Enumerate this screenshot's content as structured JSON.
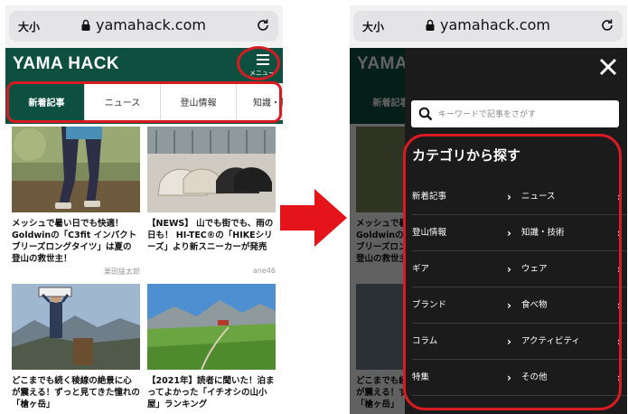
{
  "browser": {
    "aa_label": "大小",
    "domain": "yamahack.com"
  },
  "site": {
    "logo": "YAMA HACK",
    "menu_label": "メニュー"
  },
  "tabs": [
    "新着記事",
    "ニュース",
    "登山情報",
    "知識・技"
  ],
  "articles": [
    {
      "title": "メッシュで暑い日でも快適！Goldwinの「C3fit インパクトブリーズロングタイツ」は夏の登山の救世主！",
      "author": "栗田猛太郎"
    },
    {
      "title": "【NEWS】 山でも街でも、雨の日も！ HI-TEC®の「HIKEシリーズ」より新スニーカーが発売",
      "author": "ane46"
    },
    {
      "title": "どこまでも続く稜線の絶景に心が震える！ずっと見てきた憧れの「槍ヶ岳」",
      "author": ""
    },
    {
      "title": "【2021年】読者に聞いた！泊まってよかった「イチオシの山小屋」ランキング",
      "author": ""
    }
  ],
  "drawer": {
    "search_placeholder": "キーワードで記事をさがす",
    "category_title": "カテゴリから探す",
    "chevron": "›",
    "categories": [
      "新着記事",
      "ニュース",
      "登山情報",
      "知識・技術",
      "ギア",
      "ウェア",
      "ブランド",
      "食べ物",
      "コラム",
      "アクティビティ",
      "特集",
      "その他"
    ]
  },
  "colors": {
    "brand_green": "#0e5040",
    "highlight_red": "#d81b23",
    "drawer_bg": "#1b1b1b"
  }
}
